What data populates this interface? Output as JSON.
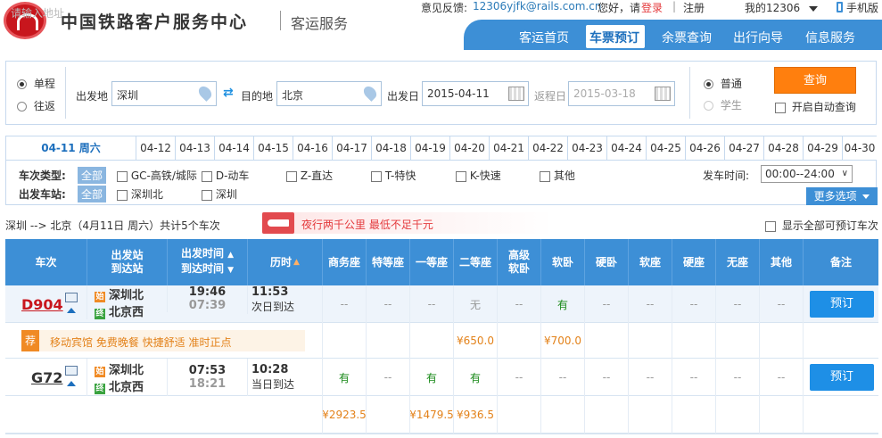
{
  "header": {
    "ghost_text": "请输入地址",
    "site_title": "中国铁路客户服务中心",
    "brand_sub": "客运服务",
    "feedback_label": "意见反馈:",
    "feedback_email": "12306yjfk@rails.com.cn",
    "greeting": "您好，请",
    "login": "登录",
    "divider": "|",
    "register": "注册",
    "my12306": "我的12306",
    "mobile": "手机版"
  },
  "nav": {
    "items": [
      "客运首页",
      "车票预订",
      "余票查询",
      "出行向导",
      "信息服务"
    ],
    "active": "车票预订"
  },
  "search": {
    "trip_types": [
      "单程",
      "往返"
    ],
    "trip_selected": "单程",
    "from_label": "出发地",
    "from_value": "深圳",
    "to_label": "目的地",
    "to_value": "北京",
    "depart_label": "出发日",
    "depart_value": "2015-04-11",
    "return_label": "返程日",
    "return_value": "2015-03-18",
    "ticket_types": [
      "普通",
      "学生"
    ],
    "ticket_selected": "普通",
    "query_button": "查询",
    "auto_query_label": "开启自动查询"
  },
  "date_tabs": {
    "active": "04-11 周六",
    "others": [
      "04-12",
      "04-13",
      "04-14",
      "04-15",
      "04-16",
      "04-17",
      "04-18",
      "04-19",
      "04-20",
      "04-21",
      "04-22",
      "04-23",
      "04-24",
      "04-25",
      "04-26",
      "04-27",
      "04-28",
      "04-29",
      "04-30"
    ]
  },
  "filters": {
    "train_type_label": "车次类型:",
    "station_label": "出发车站:",
    "all_tag": "全部",
    "train_types": [
      "GC-高铁/城际",
      "D-动车",
      "Z-直达",
      "T-特快",
      "K-快速",
      "其他"
    ],
    "stations": [
      "深圳北",
      "深圳"
    ],
    "time_label": "发车时间:",
    "time_value": "00:00--24:00",
    "more_options": "更多选项"
  },
  "route": {
    "summary": "深圳 --> 北京（4月11日 周六）共计5个车次",
    "promo": "夜行两千公里 最低不足千元",
    "show_all": "显示全部可预订车次"
  },
  "table": {
    "headers": {
      "train": "车次",
      "stations": [
        "出发站",
        "到达站"
      ],
      "times": [
        "出发时间",
        "到达时间"
      ],
      "duration": "历时",
      "seat_types": [
        "商务座",
        "特等座",
        "一等座",
        "二等座",
        "高级软卧",
        "软卧",
        "硬卧",
        "软座",
        "硬座",
        "无座",
        "其他"
      ],
      "remark": "备注"
    },
    "rows": [
      {
        "train_no": "D904",
        "from_station": "深圳北",
        "to_station": "北京西",
        "depart_time": "19:46",
        "arrive_time": "07:39",
        "duration": "11:53",
        "arrive_day": "次日到达",
        "seats": [
          "--",
          "--",
          "--",
          "无",
          "--",
          "有",
          "--",
          "--",
          "--",
          "--",
          "--"
        ],
        "book": "预订",
        "prices": [
          "",
          "",
          "",
          "¥650.0",
          "",
          "¥700.0",
          "",
          "",
          "",
          "",
          ""
        ],
        "recommend_badge": "荐",
        "recommend_text": "移动宾馆 免费晚餐 快捷舒适 准时正点"
      },
      {
        "train_no": "G72",
        "from_station": "深圳北",
        "to_station": "北京西",
        "depart_time": "07:53",
        "arrive_time": "18:21",
        "duration": "10:28",
        "arrive_day": "当日到达",
        "seats": [
          "有",
          "--",
          "有",
          "有",
          "--",
          "--",
          "--",
          "--",
          "--",
          "--",
          "--"
        ],
        "book": "预订",
        "prices": [
          "¥2923.5",
          "",
          "¥1479.5",
          "¥936.5",
          "",
          "",
          "",
          "",
          "",
          "",
          ""
        ]
      }
    ]
  },
  "colors": {
    "primary": "#3d8fd6",
    "button_orange": "#ff7f0e",
    "book_blue": "#1e8fe6",
    "accent_red": "#e4393c",
    "available_green": "#1a8a1a",
    "price_orange": "#e3821a"
  }
}
